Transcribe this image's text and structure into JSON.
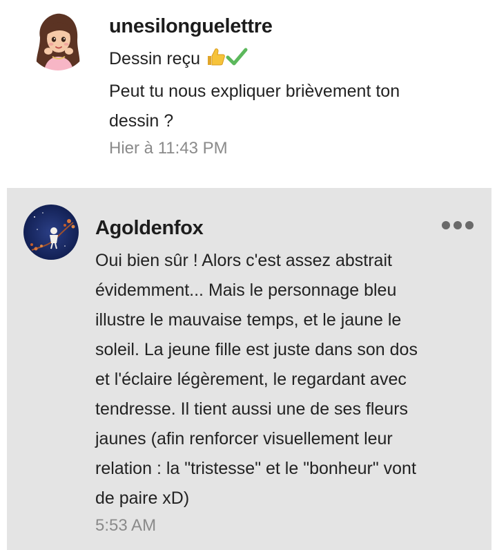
{
  "comments": [
    {
      "username": "unesilonguelettre",
      "lines": [
        "Dessin reçu",
        "Peut tu nous expliquer brièvement ton",
        "dessin ?"
      ],
      "emojis": [
        "thumbs-up-icon",
        "check-mark-icon"
      ],
      "time": "Hier à 11:43 PM"
    },
    {
      "username": "Agoldenfox",
      "lines": [
        "Oui bien sûr ! Alors c'est assez abstrait",
        "évidemment... Mais le personnage bleu",
        "illustre le mauvaise temps, et le jaune le",
        "soleil. La jeune fille est juste dans son dos",
        "et l'éclaire légèrement, le regardant avec",
        "tendresse. Il tient aussi une de ses fleurs",
        "jaunes (afin renforcer visuellement leur",
        "relation : la \"tristesse\" et le \"bonheur\" vont",
        "de paire xD)"
      ],
      "time": "5:53 AM"
    }
  ],
  "colors": {
    "highlight_bg": "#e4e4e4",
    "time_text": "#8a8a8a",
    "check_green": "#5cb85c",
    "thumb_yellow": "#f6c33a"
  }
}
